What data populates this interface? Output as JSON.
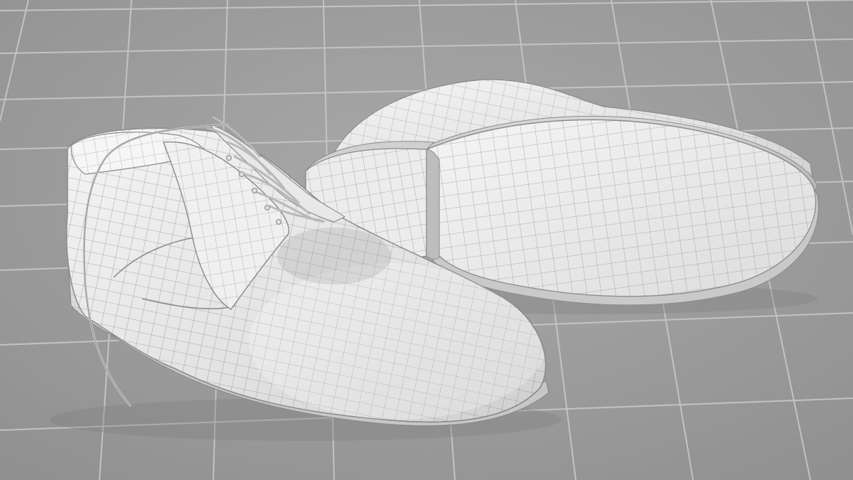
{
  "viewport": {
    "background_color": "#9a9a9a",
    "grid_line_color": "#c8c8c8",
    "model_surface_color": "#efefef",
    "model_shadow_color": "#bdbdbd",
    "wireframe_color": "#7a7a7a",
    "objects": [
      {
        "name": "left-shoe",
        "view": "upper",
        "laced": true
      },
      {
        "name": "right-shoe",
        "view": "sole"
      }
    ]
  }
}
